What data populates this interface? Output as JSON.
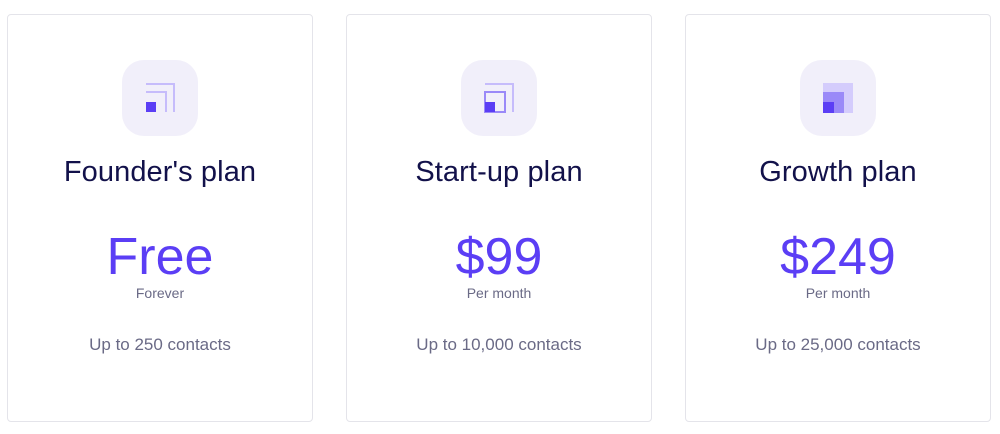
{
  "colors": {
    "accent": "#5b3ef5",
    "accent_light": "#c6bcfb",
    "tile_bg": "#f1effa",
    "title": "#12114a",
    "muted": "#6a6a86",
    "border": "#e4e4ea"
  },
  "plans": [
    {
      "icon": "founder-plan-icon",
      "name": "Founder's plan",
      "price": "Free",
      "period": "Forever",
      "contacts": "Up to 250 contacts"
    },
    {
      "icon": "startup-plan-icon",
      "name": "Start-up plan",
      "price": "$99",
      "period": "Per month",
      "contacts": "Up to 10,000 contacts"
    },
    {
      "icon": "growth-plan-icon",
      "name": "Growth plan",
      "price": "$249",
      "period": "Per month",
      "contacts": "Up to 25,000 contacts"
    }
  ]
}
